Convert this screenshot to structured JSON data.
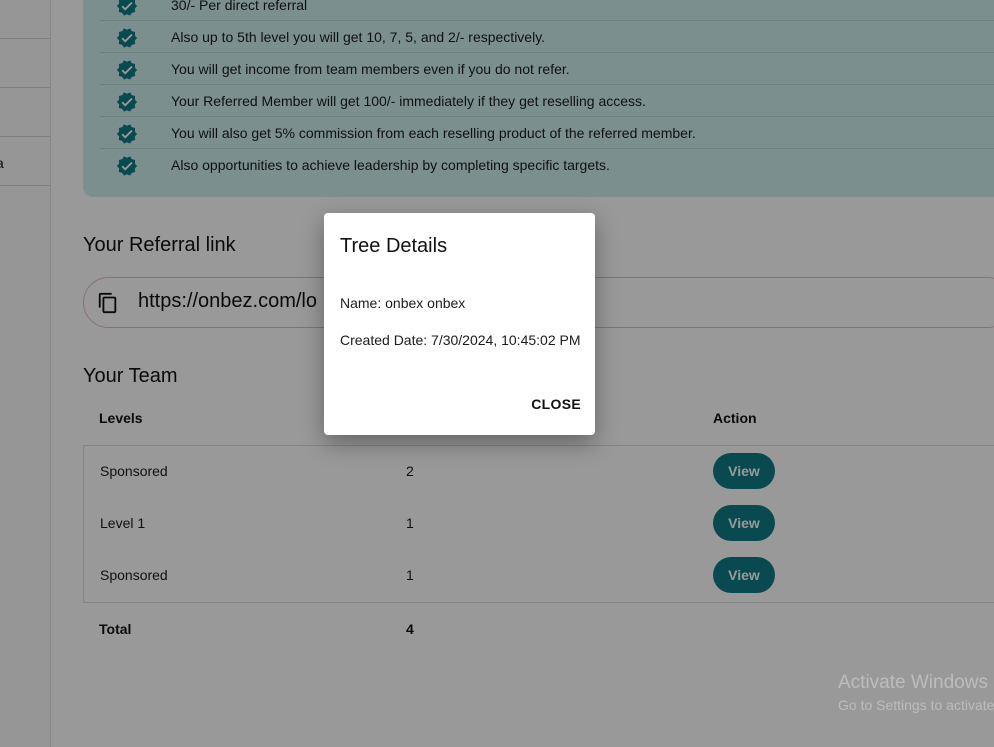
{
  "sidebar": {
    "partial_label": "a"
  },
  "benefits": {
    "items": [
      "30/- Per direct referral",
      "Also up to 5th level you will get 10, 7, 5, and 2/- respectively.",
      "You will get income from team members even if you do not refer.",
      "Your Referred Member will get 100/- immediately if they get reselling access.",
      "You will also get 5% commission from each reselling product of the referred member.",
      "Also opportunities to achieve leadership by completing specific targets."
    ],
    "icon": "verified-check-icon",
    "icon_color": "#0e7c86"
  },
  "referral": {
    "title": "Your Referral link",
    "link": "https://onbez.com/lo",
    "copy_icon": "copy-icon"
  },
  "team": {
    "title": "Your Team",
    "headers": {
      "levels": "Levels",
      "action": "Action"
    },
    "rows": [
      {
        "level": "Sponsored",
        "count": "2",
        "action": "View"
      },
      {
        "level": "Level 1",
        "count": "1",
        "action": "View"
      },
      {
        "level": "Sponsored",
        "count": "1",
        "action": "View"
      }
    ],
    "total_label": "Total",
    "total_value": "4",
    "accent": "#0e7c86"
  },
  "dialog": {
    "title": "Tree Details",
    "name_line": "Name: onbex onbex",
    "date_line": "Created Date: 7/30/2024, 10:45:02 PM",
    "close_label": "CLOSE"
  },
  "watermark": {
    "line1": "Activate Windows",
    "line2": "Go to Settings to activate Windows."
  }
}
